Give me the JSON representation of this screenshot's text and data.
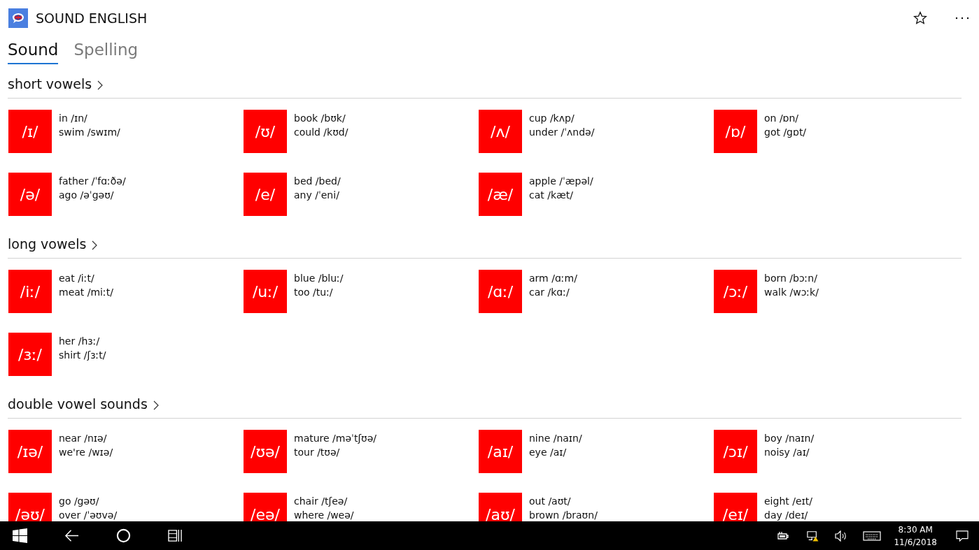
{
  "app": {
    "title": "SOUND ENGLISH"
  },
  "tabs": [
    {
      "label": "Sound",
      "selected": true
    },
    {
      "label": "Spelling",
      "selected": false
    }
  ],
  "sections": [
    {
      "title": "short vowels",
      "sounds": [
        {
          "symbol": "/ɪ/",
          "examples": [
            "in /ɪn/",
            "swim /swɪm/"
          ]
        },
        {
          "symbol": "/ʊ/",
          "examples": [
            "book /bʊk/",
            "could /kʊd/"
          ]
        },
        {
          "symbol": "/ʌ/",
          "examples": [
            "cup /kʌp/",
            "under /ˈʌndə/"
          ]
        },
        {
          "symbol": "/ɒ/",
          "examples": [
            "on /ɒn/",
            "got /gɒt/"
          ]
        },
        {
          "symbol": "/ə/",
          "examples": [
            "father /ˈfɑːðə/",
            "ago /əˈgəʊ/"
          ]
        },
        {
          "symbol": "/e/",
          "examples": [
            "bed /bed/",
            "any /ˈeni/"
          ]
        },
        {
          "symbol": "/æ/",
          "examples": [
            "apple /ˈæpəl/",
            "cat /kæt/"
          ]
        }
      ]
    },
    {
      "title": "long vowels",
      "sounds": [
        {
          "symbol": "/iː/",
          "examples": [
            "eat /iːt/",
            "meat /miːt/"
          ]
        },
        {
          "symbol": "/uː/",
          "examples": [
            "blue /bluː/",
            "too /tuː/"
          ]
        },
        {
          "symbol": "/ɑː/",
          "examples": [
            "arm /ɑːm/",
            "car /kɑː/"
          ]
        },
        {
          "symbol": "/ɔː/",
          "examples": [
            "born /bɔːn/",
            "walk /wɔːk/"
          ]
        },
        {
          "symbol": "/ɜː/",
          "examples": [
            "her /hɜː/",
            "shirt /ʃɜːt/"
          ]
        }
      ]
    },
    {
      "title": "double vowel sounds",
      "sounds": [
        {
          "symbol": "/ɪə/",
          "examples": [
            "near /nɪə/",
            "we're /wɪə/"
          ]
        },
        {
          "symbol": "/ʊə/",
          "examples": [
            "mature /məˈtʃʊə/",
            "tour /tʊə/"
          ]
        },
        {
          "symbol": "/aɪ/",
          "examples": [
            "nine /naɪn/",
            "eye /aɪ/"
          ]
        },
        {
          "symbol": "/ɔɪ/",
          "examples": [
            "boy /naɪn/",
            "noisy /aɪ/"
          ]
        },
        {
          "symbol": "/əʊ/",
          "examples": [
            "go /gəʊ/",
            "over /ˈəʊvə/"
          ]
        },
        {
          "symbol": "/eə/",
          "examples": [
            "chair /tʃeə/",
            "where /weə/"
          ]
        },
        {
          "symbol": "/aʊ/",
          "examples": [
            "out /aʊt/",
            "brown /braʊn/"
          ]
        },
        {
          "symbol": "/eɪ/",
          "examples": [
            "eight /eɪt/",
            "day /deɪ/"
          ]
        }
      ]
    }
  ],
  "taskbar": {
    "time": "8:30 AM",
    "date": "11/6/2018"
  }
}
